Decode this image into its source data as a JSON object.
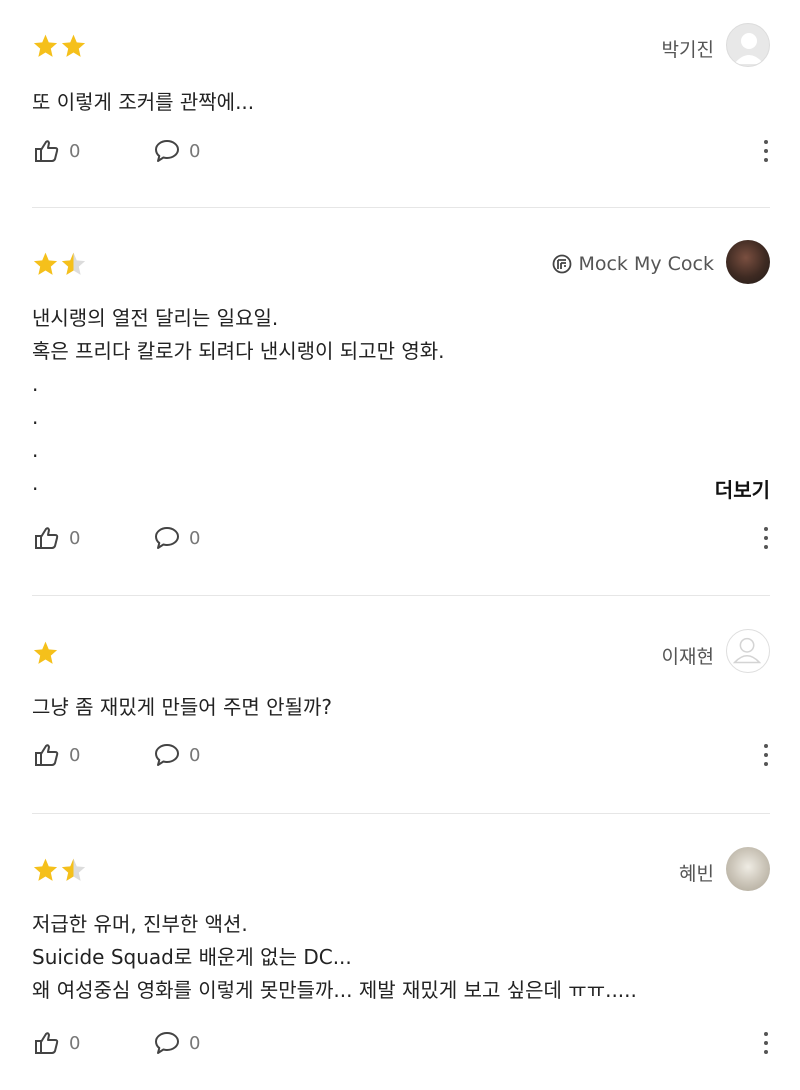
{
  "colors": {
    "star_filled": "#f5c01b",
    "star_empty": "#dcdcdc",
    "divider": "#e6e6e6"
  },
  "more_label": "더보기",
  "reviews": [
    {
      "rating": 2,
      "author": "박기진",
      "avatar": "default-avatar",
      "lines": [
        "또 이렇게 조커를 관짝에..."
      ],
      "likes": "0",
      "comments": "0"
    },
    {
      "rating": 1.5,
      "author": "Mock My Cock",
      "badge": "page-badge-icon",
      "avatar": "photo-avatar",
      "lines": [
        "낸시랭의 열전 달리는 일요일.",
        "혹은 프리다 칼로가 되려다 낸시랭이 되고만 영화.",
        ".",
        ".",
        ".",
        "."
      ],
      "more": true,
      "likes": "0",
      "comments": "0"
    },
    {
      "rating": 1,
      "author": "이재현",
      "avatar": "default-avatar",
      "lines": [
        "그냥 좀 재밌게 만들어 주면 안될까?"
      ],
      "likes": "0",
      "comments": "0"
    },
    {
      "rating": 1.5,
      "author": "혜빈",
      "avatar": "photo-avatar",
      "lines": [
        "저급한 유머, 진부한 액션.",
        "Suicide Squad로 배운게 없는 DC...",
        "왜 여성중심 영화를 이렇게 못만들까... 제발 재밌게 보고 싶은데 ㅠㅠ....."
      ],
      "likes": "0",
      "comments": "0"
    }
  ]
}
